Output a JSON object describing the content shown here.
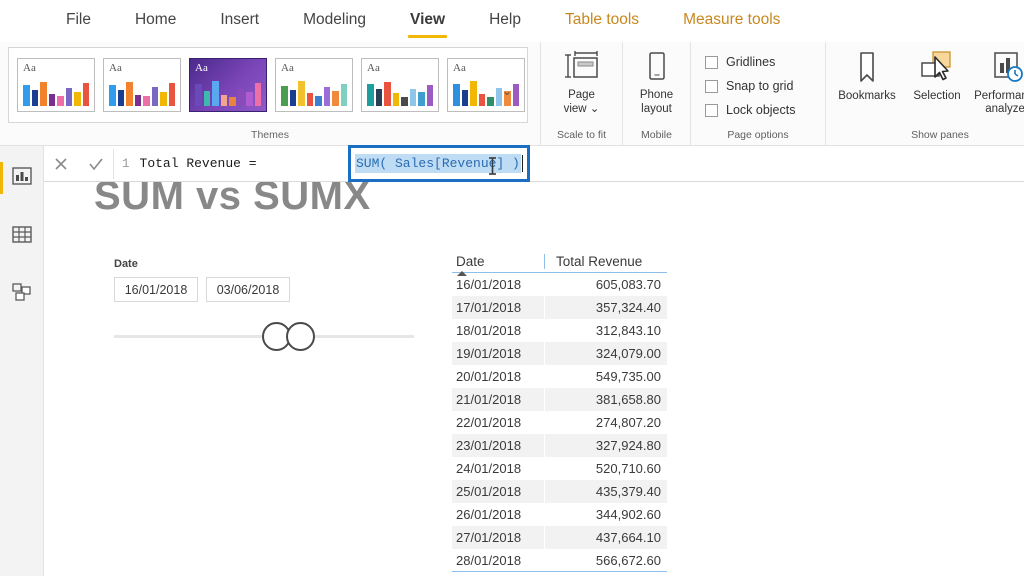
{
  "menu": {
    "items": [
      {
        "label": "File",
        "style": "normal"
      },
      {
        "label": "Home",
        "style": "normal"
      },
      {
        "label": "Insert",
        "style": "normal"
      },
      {
        "label": "Modeling",
        "style": "normal"
      },
      {
        "label": "View",
        "style": "active"
      },
      {
        "label": "Help",
        "style": "normal"
      },
      {
        "label": "Table tools",
        "style": "accent"
      },
      {
        "label": "Measure tools",
        "style": "accent"
      }
    ]
  },
  "ribbon": {
    "themes": {
      "group_label": "Themes",
      "expand_icon": "chevron-down-icon",
      "thumbs": [
        {
          "aa": "Aa",
          "selected": false,
          "colors": [
            "#2f9ced",
            "#1b3e91",
            "#f2822c",
            "#7b2d91",
            "#ee6fa8",
            "#7b68c4",
            "#f2b705",
            "#e8543f"
          ]
        },
        {
          "aa": "Aa",
          "selected": false,
          "colors": [
            "#2f9ced",
            "#1b3e91",
            "#f2822c",
            "#7b2d91",
            "#ee6fa8",
            "#7b68c4",
            "#f2b705",
            "#e8543f"
          ]
        },
        {
          "aa": "Aa",
          "selected": true,
          "colors": [
            "#6a4ab8",
            "#3fb8b0",
            "#5aa9f0",
            "#f0a58c",
            "#e8833f",
            "#8a4ab8",
            "#b05bd0",
            "#ee6fa8"
          ]
        },
        {
          "aa": "Aa",
          "selected": false,
          "colors": [
            "#4a9e52",
            "#1b3e91",
            "#f2c12e",
            "#e8543f",
            "#3f7fd0",
            "#9b6fd8",
            "#f08a3c",
            "#7fd0c0"
          ]
        },
        {
          "aa": "Aa",
          "selected": false,
          "colors": [
            "#1f9e9e",
            "#2a3f55",
            "#e8543f",
            "#f2b705",
            "#4a4a4a",
            "#8fc5e8",
            "#3f9ed0",
            "#9b5bc0"
          ]
        },
        {
          "aa": "Aa",
          "selected": false,
          "colors": [
            "#2f8fe0",
            "#1b3e91",
            "#f2b705",
            "#e8543f",
            "#2f8f6a",
            "#8fc5e8",
            "#f08a3c",
            "#9b5bc0"
          ]
        }
      ]
    },
    "scale_to_fit": {
      "group_label": "Scale to fit",
      "button_label": "Page\nview ⌄",
      "icon": "page-view-icon"
    },
    "mobile": {
      "group_label": "Mobile",
      "button_label": "Phone\nlayout",
      "icon": "phone-layout-icon"
    },
    "page_options": {
      "group_label": "Page options",
      "checkboxes": [
        {
          "label": "Gridlines",
          "checked": false
        },
        {
          "label": "Snap to grid",
          "checked": false
        },
        {
          "label": "Lock objects",
          "checked": false
        }
      ]
    },
    "show_panes": {
      "group_label": "Show panes",
      "buttons": [
        {
          "label": "Bookmarks",
          "icon": "bookmark-icon"
        },
        {
          "label": "Selection",
          "icon": "selection-pane-icon"
        },
        {
          "label": "Performance\nanalyzer",
          "icon": "performance-analyzer-icon"
        }
      ]
    }
  },
  "formula_bar": {
    "cancel_icon": "close-icon",
    "commit_icon": "check-icon",
    "line_number": "1",
    "expression_prefix": "Total Revenue = ",
    "selected_expression": "SUM( Sales[Revenue] )",
    "cursor_icon": "text-ibeam-cursor"
  },
  "left_rail": {
    "items": [
      {
        "name": "report-view",
        "icon": "bar-chart-icon",
        "selected": true
      },
      {
        "name": "data-view",
        "icon": "table-grid-icon",
        "selected": false
      },
      {
        "name": "model-view",
        "icon": "model-relationships-icon",
        "selected": false
      }
    ]
  },
  "canvas": {
    "title": "SUM vs SUMX",
    "slicer": {
      "label": "Date",
      "start_value": "16/01/2018",
      "end_value": "03/06/2018"
    },
    "table": {
      "columns": [
        "Date",
        "Total Revenue"
      ],
      "sort_column": "Date",
      "sort_direction": "ascending",
      "rows": [
        [
          "16/01/2018",
          "605,083.70"
        ],
        [
          "17/01/2018",
          "357,324.40"
        ],
        [
          "18/01/2018",
          "312,843.10"
        ],
        [
          "19/01/2018",
          "324,079.00"
        ],
        [
          "20/01/2018",
          "549,735.00"
        ],
        [
          "21/01/2018",
          "381,658.80"
        ],
        [
          "22/01/2018",
          "274,807.20"
        ],
        [
          "23/01/2018",
          "327,924.80"
        ],
        [
          "24/01/2018",
          "520,710.60"
        ],
        [
          "25/01/2018",
          "435,379.40"
        ],
        [
          "26/01/2018",
          "344,902.60"
        ],
        [
          "27/01/2018",
          "437,664.10"
        ],
        [
          "28/01/2018",
          "566,672.60"
        ]
      ]
    }
  },
  "colors": {
    "accent_yellow": "#f2b705",
    "tab_accent_orange": "#c8881f",
    "selection_blue": "#1a6fc4",
    "table_line_blue": "#8fbfe8"
  }
}
